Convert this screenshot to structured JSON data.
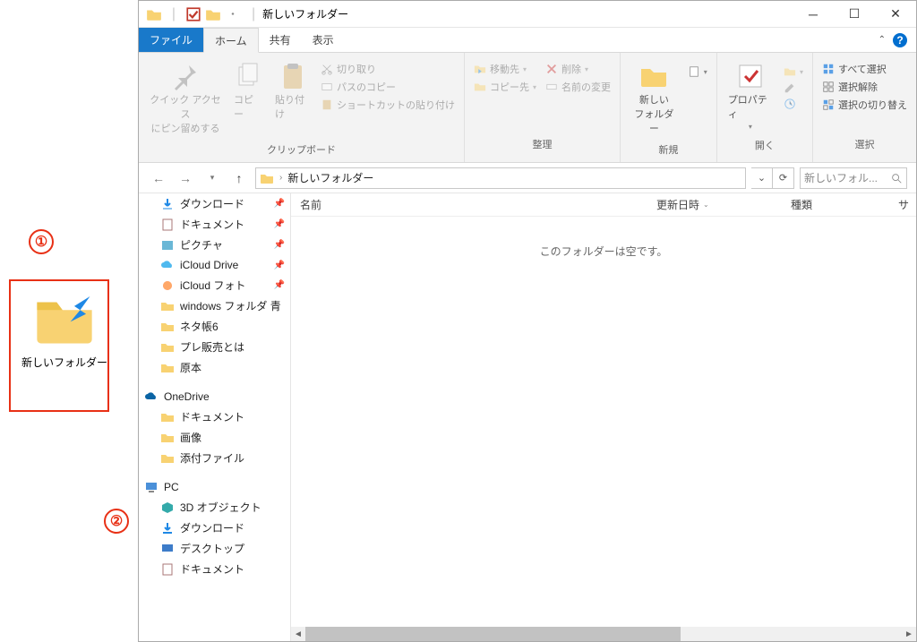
{
  "annotations": {
    "num1": "①",
    "num2": "②"
  },
  "desktop_icon": {
    "label": "新しいフォルダー"
  },
  "titlebar": {
    "title": "新しいフォルダー",
    "sep": "|"
  },
  "tabs": {
    "file": "ファイル",
    "home": "ホーム",
    "share": "共有",
    "view": "表示"
  },
  "ribbon": {
    "clipboard": {
      "quick_pin": "クイック アクセス\nにピン留めする",
      "copy": "コピー",
      "paste": "貼り付け",
      "cut": "切り取り",
      "copy_path": "パスのコピー",
      "paste_shortcut": "ショートカットの貼り付け",
      "label": "クリップボード"
    },
    "organize": {
      "move_to": "移動先",
      "copy_to": "コピー先",
      "delete": "削除",
      "rename": "名前の変更",
      "label": "整理"
    },
    "new": {
      "new_folder": "新しい\nフォルダー",
      "label": "新規"
    },
    "open": {
      "properties": "プロパティ",
      "label": "開く"
    },
    "select": {
      "select_all": "すべて選択",
      "select_none": "選択解除",
      "invert": "選択の切り替え",
      "label": "選択"
    }
  },
  "address": {
    "root_sep": "›",
    "crumb1": "新しいフォルダー"
  },
  "search": {
    "placeholder": "新しいフォル..."
  },
  "columns": {
    "name": "名前",
    "date": "更新日時",
    "type": "種類",
    "size": "サ"
  },
  "empty_msg": "このフォルダーは空です。",
  "tree": {
    "downloads": "ダウンロード",
    "documents": "ドキュメント",
    "pictures": "ピクチャ",
    "icloud_drive": "iCloud Drive",
    "icloud_photo": "iCloud フォト",
    "windows_folder": "windows フォルダ 青",
    "neta6": "ネタ帳6",
    "presale": "プレ販売とは",
    "genpon": "原本",
    "onedrive": "OneDrive",
    "od_docs": "ドキュメント",
    "od_images": "画像",
    "od_attach": "添付ファイル",
    "pc": "PC",
    "pc_3d": "3D オブジェクト",
    "pc_downloads": "ダウンロード",
    "pc_desktop": "デスクトップ",
    "pc_documents": "ドキュメント"
  }
}
